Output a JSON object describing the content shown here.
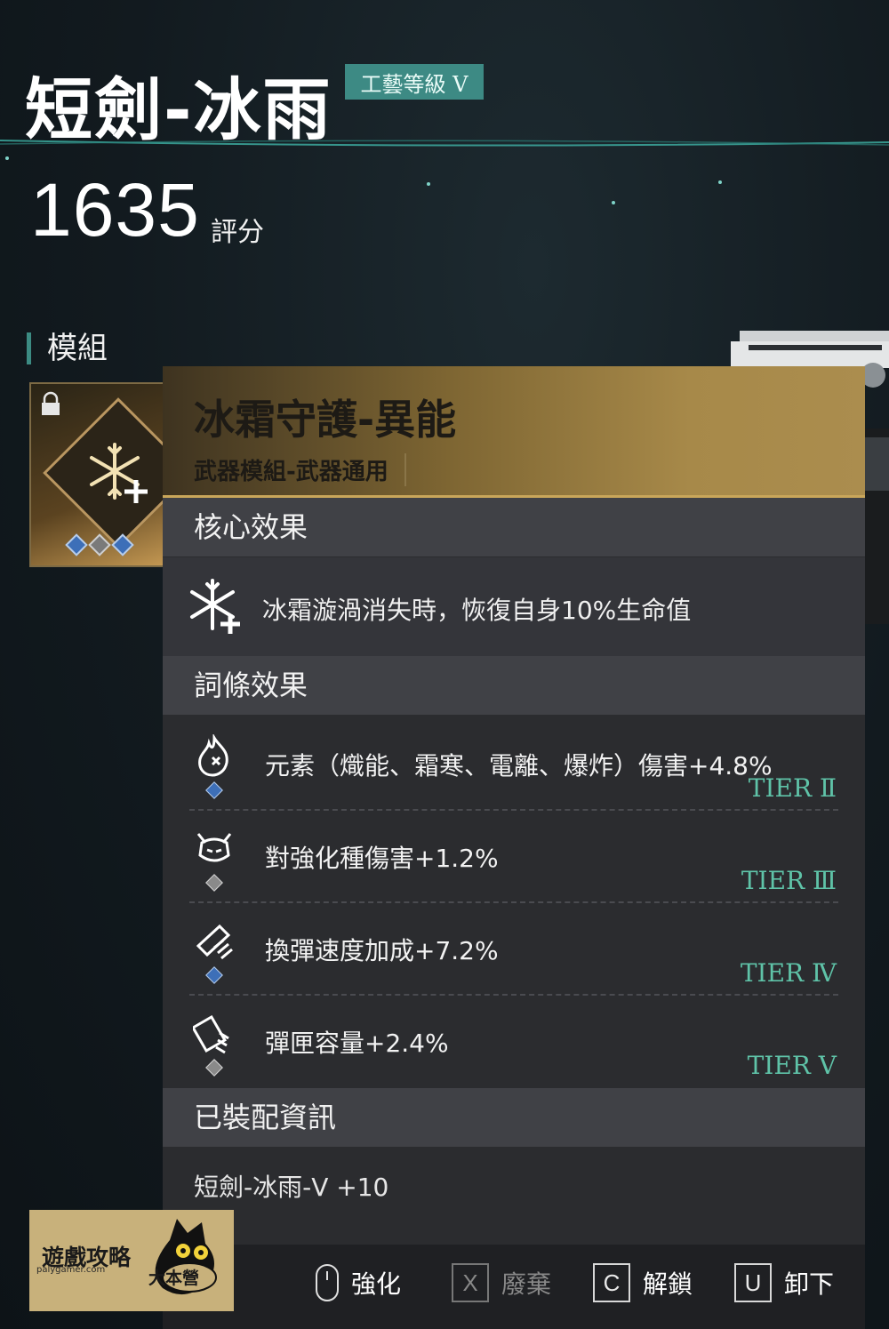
{
  "header": {
    "title": "短劍-冰雨",
    "craft_level": "工藝等級 V",
    "score": "1635",
    "score_label": "評分"
  },
  "section_mod_label": "模組",
  "popup": {
    "title": "冰霜守護-異能",
    "subtitle": "武器模組-武器通用",
    "core_header": "核心效果",
    "core_effect": "冰霜漩渦消失時，恢復自身10%生命值",
    "affix_header": "詞條效果",
    "affixes": [
      {
        "text": "元素（熾能、霜寒、電離、爆炸）傷害+4.8%",
        "tier": "TIER Ⅱ",
        "pip": "blue",
        "icon": "flame-element-icon"
      },
      {
        "text": "對強化種傷害+1.2%",
        "tier": "TIER Ⅲ",
        "pip": "gray",
        "icon": "enhanced-monster-icon"
      },
      {
        "text": "換彈速度加成+7.2%",
        "tier": "TIER Ⅳ",
        "pip": "blue",
        "icon": "reload-speed-icon"
      },
      {
        "text": "彈匣容量+2.4%",
        "tier": "TIER Ⅴ",
        "pip": "gray",
        "icon": "magazine-icon"
      }
    ],
    "equipped_header": "已裝配資訊",
    "equipped_info": "短劍-冰雨-Ⅴ +10"
  },
  "actions": {
    "enhance": "強化",
    "discard_key": "X",
    "discard": "廢棄",
    "unlock_key": "C",
    "unlock": "解鎖",
    "unequip_key": "U",
    "unequip": "卸下"
  },
  "watermark": {
    "title": "遊戲攻略",
    "url": "palygamer.com",
    "badge": "大本營"
  },
  "colors": {
    "accent_teal": "#3d8a84",
    "tier_green": "#5fc3a8",
    "gold": "#a78949"
  }
}
